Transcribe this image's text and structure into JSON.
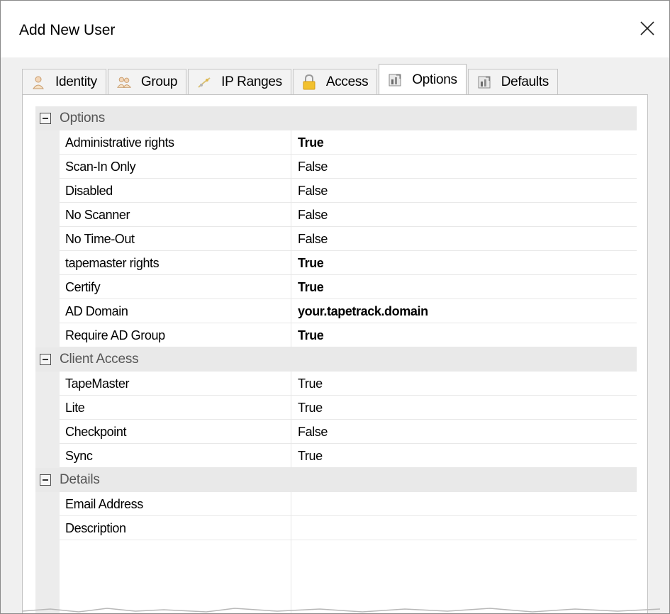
{
  "window": {
    "title": "Add New User"
  },
  "tabs": [
    {
      "label": "Identity",
      "icon": "person-icon",
      "active": false
    },
    {
      "label": "Group",
      "icon": "group-icon",
      "active": false
    },
    {
      "label": "IP Ranges",
      "icon": "network-icon",
      "active": false
    },
    {
      "label": "Access",
      "icon": "lock-icon",
      "active": false
    },
    {
      "label": "Options",
      "icon": "options-icon",
      "active": true
    },
    {
      "label": "Defaults",
      "icon": "defaults-icon",
      "active": false
    }
  ],
  "categories": [
    {
      "label": "Options",
      "rows": [
        {
          "name": "Administrative rights",
          "value": "True"
        },
        {
          "name": "Scan-In Only",
          "value": "False"
        },
        {
          "name": "Disabled",
          "value": "False"
        },
        {
          "name": "No Scanner",
          "value": "False"
        },
        {
          "name": "No Time-Out",
          "value": "False"
        },
        {
          "name": "tapemaster rights",
          "value": "True"
        },
        {
          "name": "Certify",
          "value": "True"
        },
        {
          "name": "AD Domain",
          "value": "your.tapetrack.domain"
        },
        {
          "name": "Require AD Group",
          "value": "True"
        }
      ]
    },
    {
      "label": "Client Access",
      "rows": [
        {
          "name": "TapeMaster",
          "value": "True"
        },
        {
          "name": "Lite",
          "value": "True"
        },
        {
          "name": "Checkpoint",
          "value": "False"
        },
        {
          "name": "Sync",
          "value": "True"
        }
      ]
    },
    {
      "label": "Details",
      "rows": [
        {
          "name": "Email Address",
          "value": ""
        },
        {
          "name": "Description",
          "value": ""
        }
      ]
    }
  ]
}
